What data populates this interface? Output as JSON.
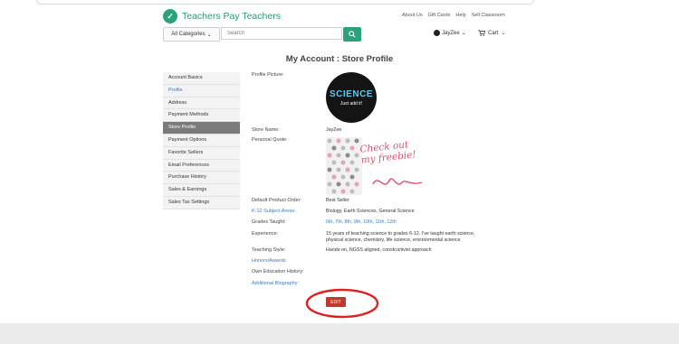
{
  "header": {
    "brand": "Teachers Pay Teachers",
    "links": [
      "About Us",
      "Gift Cards",
      "Help",
      "Sell Classroom"
    ],
    "category_label": "All Categories",
    "search_placeholder": "Search",
    "user_name": "JayZee",
    "cart_label": "Cart"
  },
  "page": {
    "title": "My Account : Store Profile"
  },
  "sidebar": {
    "items": [
      {
        "label": "Account Basics",
        "style": "normal"
      },
      {
        "label": "Profile",
        "style": "link"
      },
      {
        "label": "Address",
        "style": "normal"
      },
      {
        "label": "Payment Methods",
        "style": "normal"
      },
      {
        "label": "Store Profile",
        "style": "active"
      },
      {
        "label": "Payment Options",
        "style": "normal"
      },
      {
        "label": "Favorite Sellers",
        "style": "normal"
      },
      {
        "label": "Email Preferences",
        "style": "normal"
      },
      {
        "label": "Purchase History",
        "style": "normal"
      },
      {
        "label": "Sales & Earnings",
        "style": "normal"
      },
      {
        "label": "Sales Tax Settings",
        "style": "normal"
      }
    ]
  },
  "profile": {
    "picture_label": "Profile Picture:",
    "picture_title": "SCIENCE",
    "picture_subtitle": "Just add it!",
    "store_name_label": "Store Name:",
    "store_name": "JayZee",
    "quote_label": "Personal Quote:",
    "quote_text": "Check out my freebie!",
    "default_order_label": "Default Product Order:",
    "default_order": "Best Seller",
    "subject_label": "K-12 Subject Areas:",
    "subjects": "Biology, Earth Sciences, General Science",
    "grades_label": "Grades Taught:",
    "grades": "6th, 7th, 8th, 9th, 10th, 11th, 12th",
    "experience_label": "Experience:",
    "experience_line1": "15 years of teaching science to grades 6-12. I've taught earth science,",
    "experience_line2": "physical science, chemistry, life science, environmental science",
    "style_label": "Teaching Style:",
    "teaching_style": "Hands-on, NGSS aligned, constructivist approach",
    "honors_label": "Honors/Awards:",
    "education_label": "Own Education History:",
    "additional_label": "Additional Biography:",
    "edit_label": "EDIT"
  },
  "colors": {
    "brand_green": "#2aa37a",
    "edit_red": "#c0392b",
    "annotation_red": "#e0201c"
  }
}
